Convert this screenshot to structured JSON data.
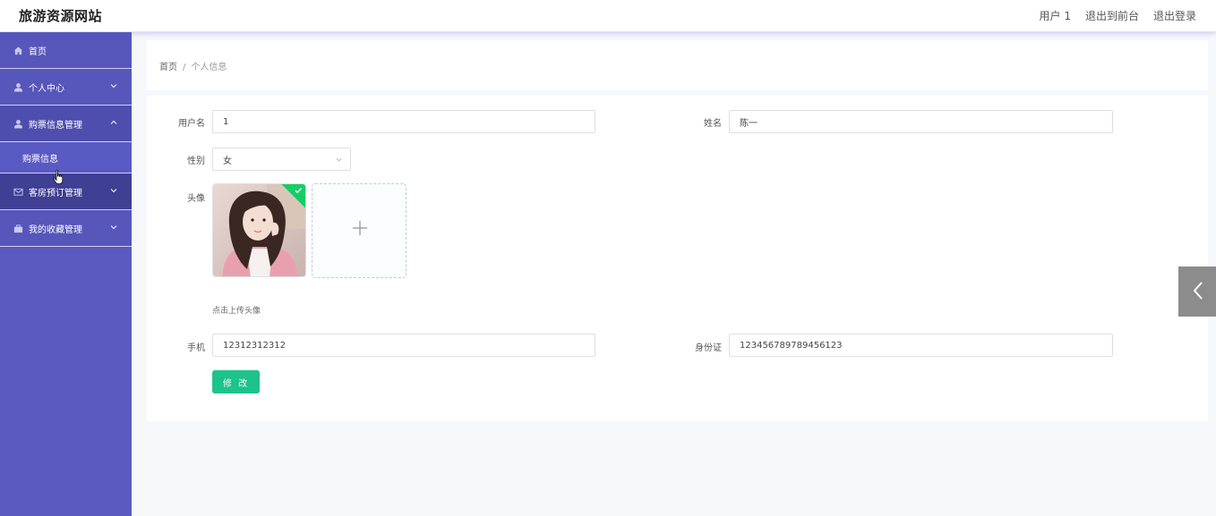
{
  "header": {
    "site_title": "旅游资源网站",
    "user": "用户 1",
    "to_front": "退出到前台",
    "logout": "退出登录"
  },
  "sidebar": {
    "items": [
      {
        "label": "首页",
        "icon": "home-icon"
      },
      {
        "label": "个人中心",
        "icon": "user-icon"
      },
      {
        "label": "购票信息管理",
        "icon": "user-icon",
        "open": true,
        "children": [
          {
            "label": "购票信息"
          }
        ]
      },
      {
        "label": "客房预订管理",
        "icon": "mail-icon"
      },
      {
        "label": "我的收藏管理",
        "icon": "briefcase-icon"
      }
    ]
  },
  "breadcrumb": {
    "home": "首页",
    "separator": "/",
    "current": "个人信息"
  },
  "form": {
    "username_label": "用户名",
    "username_value": "1",
    "name_label": "姓名",
    "name_value": "陈一",
    "gender_label": "性别",
    "gender_value": "女",
    "avatar_label": "头像",
    "avatar_hint": "点击上传头像",
    "phone_label": "手机",
    "phone_value": "12312312312",
    "id_label": "身份证",
    "id_value": "123456789789456123",
    "submit_label": "修 改"
  },
  "colors": {
    "sidebar": "#5a5ac0",
    "submit": "#1ec28b",
    "upload_check": "#13ce66"
  }
}
